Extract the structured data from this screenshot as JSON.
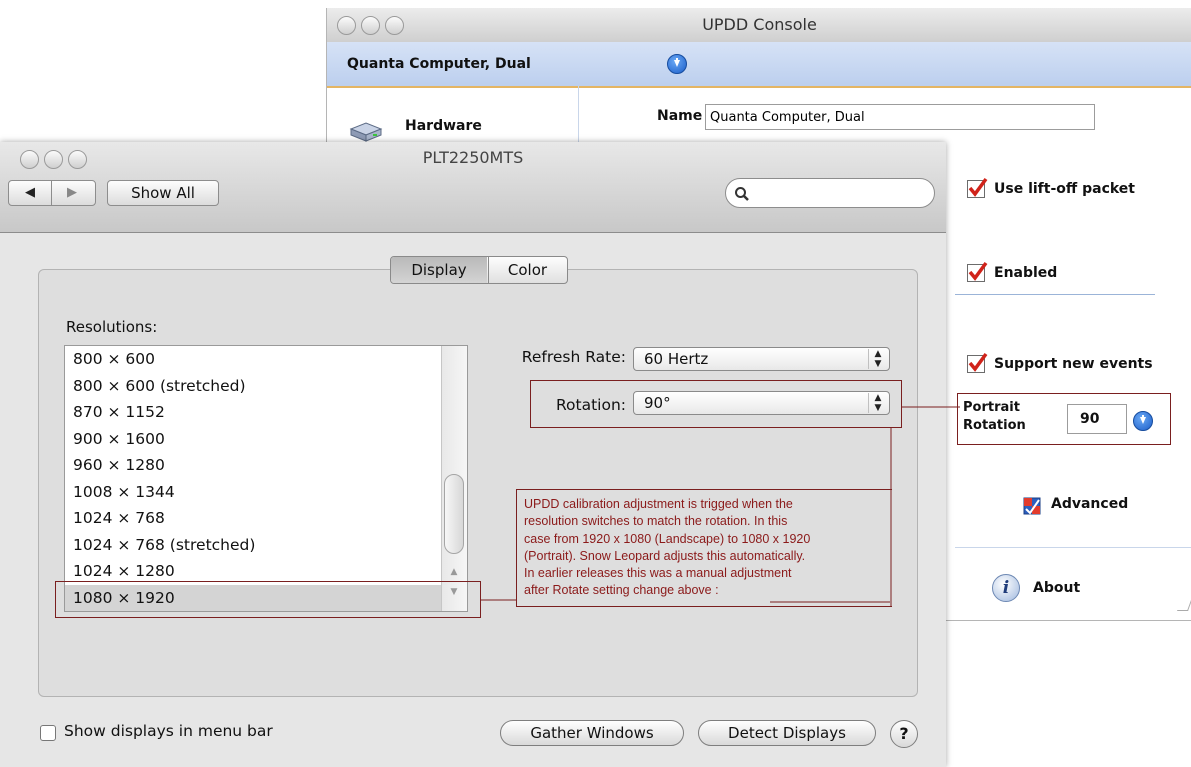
{
  "updd_console": {
    "title": "UPDD Console",
    "device_name": "Quanta Computer, Dual",
    "sidebar": {
      "hardware_label": "Hardware"
    },
    "name_label": "Name",
    "name_value": "Quanta Computer, Dual",
    "options": [
      {
        "label": "Use lift-off packet",
        "checked": true
      },
      {
        "label": "Enabled",
        "checked": true
      },
      {
        "label": "Support new events",
        "checked": true
      }
    ],
    "portrait_rotation": {
      "label_line1": "Portrait",
      "label_line2": "Rotation",
      "value": "90"
    },
    "advanced_label": "Advanced",
    "about_label": "About"
  },
  "prefs_window": {
    "title": "PLT2250MTS",
    "toolbar": {
      "back_glyph": "◀",
      "forward_glyph": "▶",
      "show_all_label": "Show All",
      "search_placeholder": ""
    },
    "tabs": [
      {
        "label": "Display",
        "selected": true
      },
      {
        "label": "Color",
        "selected": false
      }
    ],
    "resolutions_label": "Resolutions:",
    "resolutions": [
      "800 × 600",
      "800 × 600 (stretched)",
      "870 × 1152",
      "900 × 1600",
      "960 × 1280",
      "1008 × 1344",
      "1024 × 768",
      "1024 × 768 (stretched)",
      "1024 × 1280",
      "1080 × 1920"
    ],
    "selected_resolution_index": 9,
    "refresh_rate": {
      "label": "Refresh Rate:",
      "value": "60 Hertz"
    },
    "rotation": {
      "label": "Rotation:",
      "value": "90°"
    },
    "show_displays_in_menu_bar": {
      "label": "Show displays in menu bar",
      "checked": false
    },
    "gather_windows_label": "Gather Windows",
    "detect_displays_label": "Detect Displays",
    "help_label": "?"
  },
  "annotation": {
    "lines": [
      "UPDD calibration adjustment is trigged when the",
      "resolution switches to match the rotation.  In this",
      "case from 1920 x 1080 (Landscape) to 1080 x 1920",
      "(Portrait). Snow Leopard adjusts this automatically.",
      "In earlier releases this was a manual adjustment",
      "after Rotate setting change above :"
    ],
    "color": "#8b1a1a"
  },
  "colors": {
    "accent_blue": "#1c5ec9",
    "check_red": "#d0231a",
    "annotation_border": "#7a1f1f"
  }
}
